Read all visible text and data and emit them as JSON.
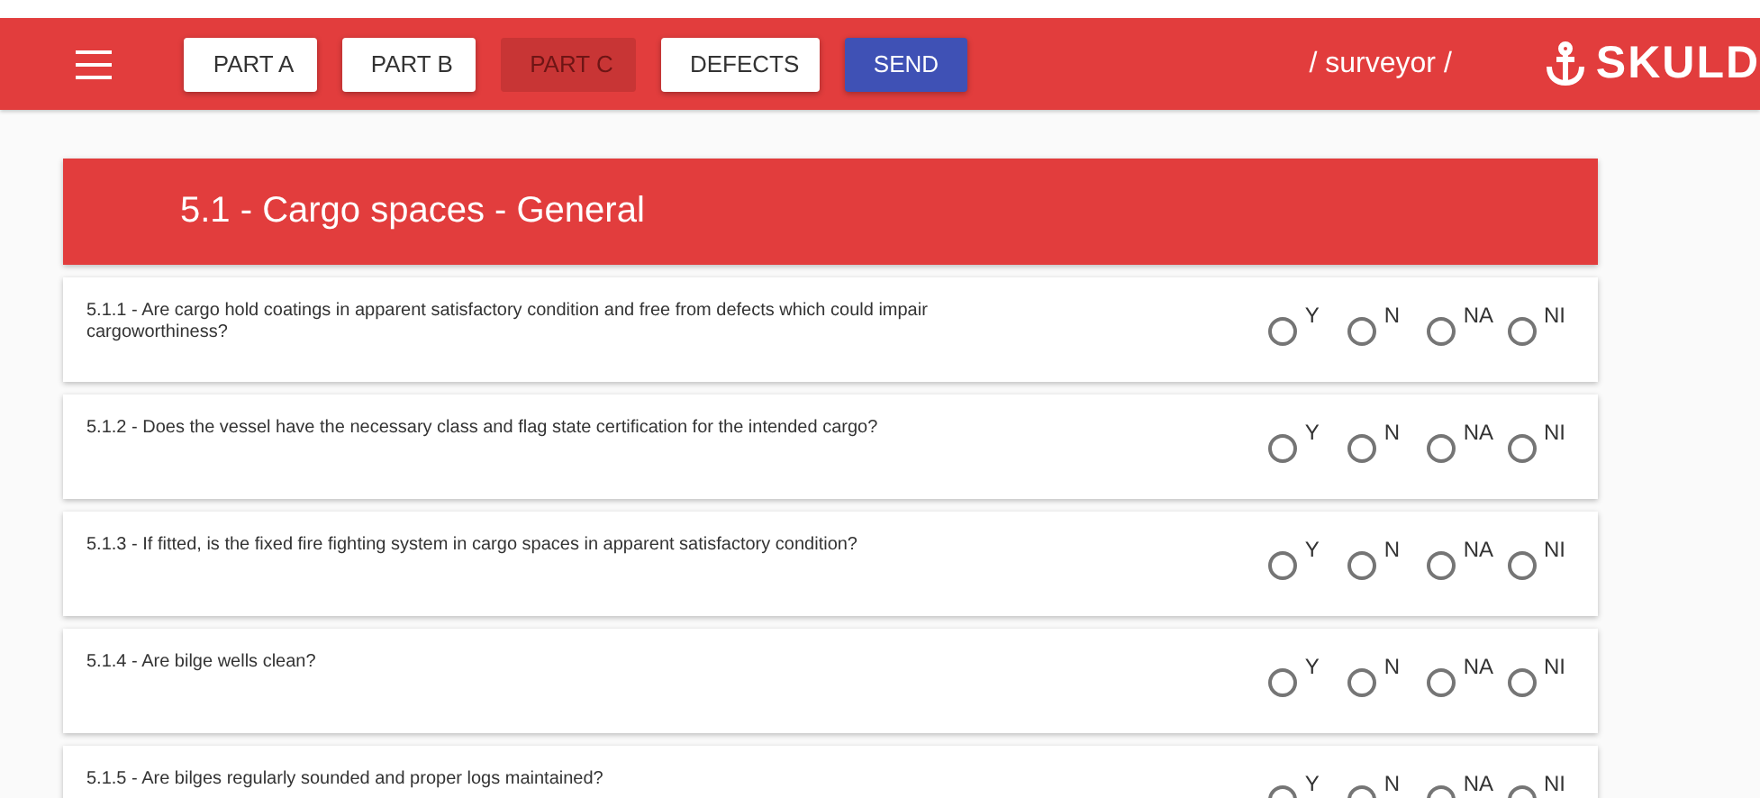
{
  "header": {
    "tabs": [
      {
        "label": "PART A",
        "selected": false
      },
      {
        "label": "PART B",
        "selected": false
      },
      {
        "label": "PART C",
        "selected": true
      },
      {
        "label": "DEFECTS",
        "selected": false
      }
    ],
    "send_button": "SEND",
    "role": "/ surveyor /",
    "logo_text": "SKULD"
  },
  "section": {
    "title": "5.1 - Cargo spaces - General",
    "questions": [
      {
        "text": "5.1.1 - Are cargo hold coatings in apparent satisfactory condition and free from defects which could impair cargoworthiness?",
        "options": [
          {
            "label": "Y",
            "selected": false
          },
          {
            "label": "N",
            "selected": false
          },
          {
            "label": "NA",
            "selected": false
          },
          {
            "label": "NI",
            "selected": false
          }
        ]
      },
      {
        "text": "5.1.2 - Does the vessel have the necessary class and flag state certification for the intended cargo?",
        "options": [
          {
            "label": "Y",
            "selected": false
          },
          {
            "label": "N",
            "selected": false
          },
          {
            "label": "NA",
            "selected": false
          },
          {
            "label": "NI",
            "selected": false
          }
        ]
      },
      {
        "text": "5.1.3 - If fitted, is the fixed fire fighting system in cargo spaces in apparent satisfactory condition?",
        "options": [
          {
            "label": "Y",
            "selected": false
          },
          {
            "label": "N",
            "selected": false
          },
          {
            "label": "NA",
            "selected": false
          },
          {
            "label": "NI",
            "selected": false
          }
        ]
      },
      {
        "text": "5.1.4 - Are bilge wells clean?",
        "options": [
          {
            "label": "Y",
            "selected": false
          },
          {
            "label": "N",
            "selected": false
          },
          {
            "label": "NA",
            "selected": false
          },
          {
            "label": "NI",
            "selected": false
          }
        ]
      },
      {
        "text": "5.1.5 - Are bilges regularly sounded and proper logs maintained?",
        "options": [
          {
            "label": "Y",
            "selected": false
          },
          {
            "label": "N",
            "selected": false
          },
          {
            "label": "NA",
            "selected": false
          },
          {
            "label": "NI",
            "selected": false
          }
        ]
      }
    ]
  }
}
